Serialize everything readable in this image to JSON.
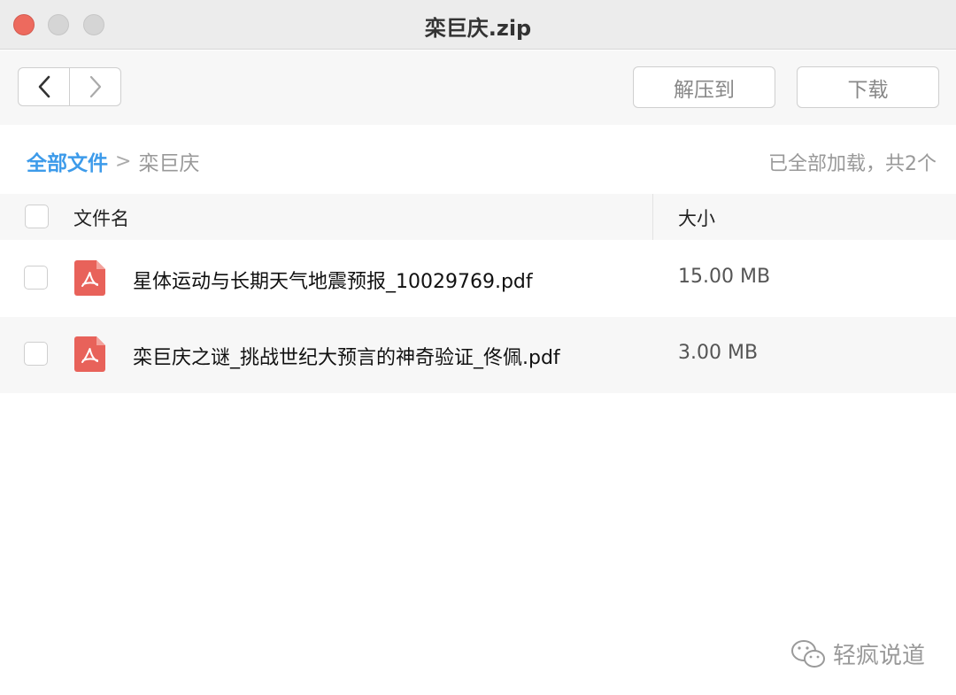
{
  "window": {
    "title": "栾巨庆.zip"
  },
  "toolbar": {
    "extract_label": "解压到",
    "download_label": "下载"
  },
  "breadcrumb": {
    "root": "全部文件",
    "separator": ">",
    "current": "栾巨庆"
  },
  "status": {
    "loaded_text": "已全部加载，共2个"
  },
  "table": {
    "columns": {
      "name": "文件名",
      "size": "大小"
    },
    "rows": [
      {
        "name": "星体运动与长期天气地震预报_10029769.pdf",
        "size": "15.00 MB",
        "icon": "pdf-icon"
      },
      {
        "name": "栾巨庆之谜_挑战世纪大预言的神奇验证_佟佩.pdf",
        "size": "3.00 MB",
        "icon": "pdf-icon"
      }
    ]
  },
  "watermark": {
    "text": "轻疯说道",
    "icon": "wechat-icon"
  },
  "colors": {
    "accent": "#3d9bea",
    "pdf": "#e8625a",
    "close": "#ed6a5e"
  }
}
